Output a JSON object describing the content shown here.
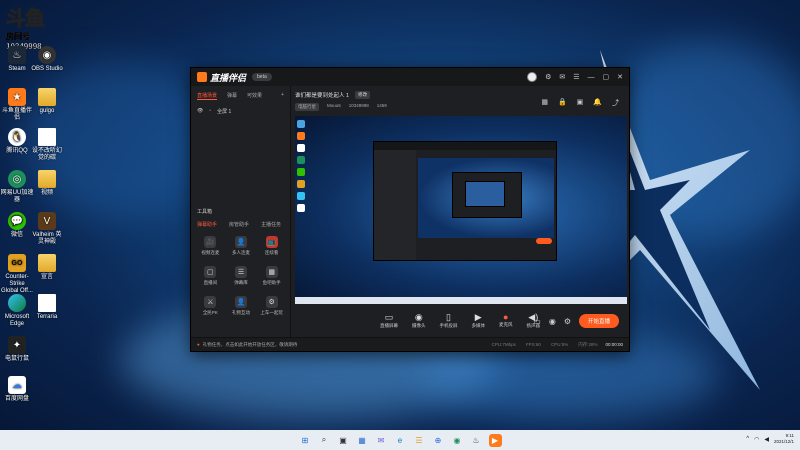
{
  "overlay": {
    "title": "斗鱼",
    "room_label": "房间号",
    "room_number": "10349998"
  },
  "desktop_icons": [
    {
      "label": "Steam",
      "col": 0
    },
    {
      "label": "OBS Studio",
      "col": 1
    },
    {
      "label": "斗鱼直播伴侣",
      "col": 0
    },
    {
      "label": "gulgo",
      "col": 1
    },
    {
      "label": "腾讯QQ",
      "col": 0
    },
    {
      "label": "设不改听幻觉的碳",
      "col": 1
    },
    {
      "label": "网易UU加速器",
      "col": 0
    },
    {
      "label": "视频",
      "col": 1
    },
    {
      "label": "微信",
      "col": 0
    },
    {
      "label": "Valheim 英灵神殿",
      "col": 1
    },
    {
      "label": "Counter-Strike Global Off...",
      "col": 0
    },
    {
      "label": "宣言",
      "col": 1
    },
    {
      "label": "Microsoft Edge",
      "col": 0
    },
    {
      "label": "Terraria",
      "col": 1
    },
    {
      "label": "电鼠行鼠",
      "col": 0
    },
    {
      "label": "百度网盘",
      "col": 0
    }
  ],
  "app": {
    "logo": "直播伴侣",
    "version": "beta",
    "left_tabs": [
      "直播场景",
      "弹幕",
      "可效果"
    ],
    "scene": "全屏 1",
    "tools_title": "工具箱",
    "tools_tabs": [
      "弹幕助手",
      "房管助手",
      "主播任务"
    ],
    "tools": [
      {
        "label": "视频连麦",
        "icon": "🎥"
      },
      {
        "label": "多人连麦",
        "icon": "👤"
      },
      {
        "label": "连续看",
        "icon": "📺"
      },
      {
        "label": "直播间",
        "icon": "▢"
      },
      {
        "label": "弹幕库",
        "icon": "☰"
      },
      {
        "label": "鱼吧助手",
        "icon": "▦"
      },
      {
        "label": "全民PK",
        "icon": "⚔"
      },
      {
        "label": "礼物互动",
        "icon": "👤"
      },
      {
        "label": "上车一起玩",
        "icon": "⚙"
      }
    ],
    "stream_title": "谁们都是要到处起人 1",
    "edit_tag": "修改",
    "category_tag": "电脑行星",
    "streamer": "Mouu5",
    "room": "10349998",
    "heat": "1459",
    "bottom_actions": [
      {
        "label": "直播屏幕",
        "icon": "▭"
      },
      {
        "label": "摄像头",
        "icon": "◉"
      },
      {
        "label": "手机投屏",
        "icon": "▯"
      },
      {
        "label": "多媒体",
        "icon": "▶"
      },
      {
        "label": "麦克风",
        "icon": "●"
      },
      {
        "label": "扬声器",
        "icon": "◀)"
      }
    ],
    "start_live": "开始直播",
    "status_warning": "礼物任务，点击如此开始开放任务区，敬请期待",
    "status_stats": [
      "CPU:7Mbps",
      "FPS:60",
      "CPU:5%",
      "内存:28%"
    ],
    "status_time": "00:00:00"
  },
  "taskbar": {
    "apps": [
      "⊞",
      "⌕",
      "▣",
      "▦",
      "✉",
      "e",
      "☰",
      "⊕",
      "◉",
      "♨",
      "▶"
    ],
    "clock_time": "9:11",
    "clock_date": "2021/12/1"
  }
}
